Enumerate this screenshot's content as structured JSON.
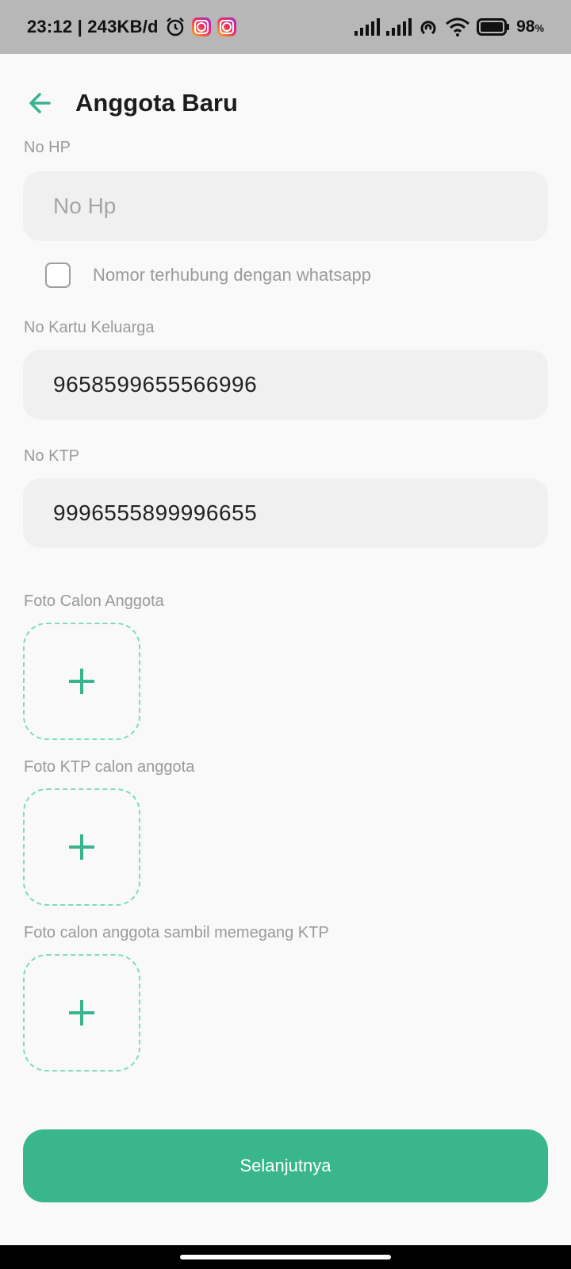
{
  "status_bar": {
    "time_speed": "23:12 | 243KB/d",
    "battery_percent": "98",
    "battery_unit": "%",
    "icons": [
      "alarm-icon",
      "instagram-icon",
      "instagram-icon",
      "signal-icon",
      "signal-icon",
      "hotspot-icon",
      "wifi-icon",
      "battery-icon"
    ]
  },
  "header": {
    "title": "Anggota Baru"
  },
  "form": {
    "phone": {
      "label": "No HP",
      "placeholder": "No Hp",
      "value": ""
    },
    "whatsapp_checkbox": {
      "label": "Nomor terhubung dengan whatsapp",
      "checked": false
    },
    "kk": {
      "label": "No Kartu Keluarga",
      "value": "9658599655566996"
    },
    "ktp": {
      "label": "No KTP",
      "value": "9996555899996655"
    },
    "uploads": [
      {
        "label": "Foto Calon Anggota"
      },
      {
        "label": "Foto KTP calon anggota"
      },
      {
        "label": "Foto calon anggota sambil memegang KTP"
      }
    ]
  },
  "actions": {
    "next_label": "Selanjutnya"
  },
  "colors": {
    "accent": "#3ab68d",
    "dashed_border": "#7fdcc0",
    "status_bar": "#b7b7b7"
  }
}
